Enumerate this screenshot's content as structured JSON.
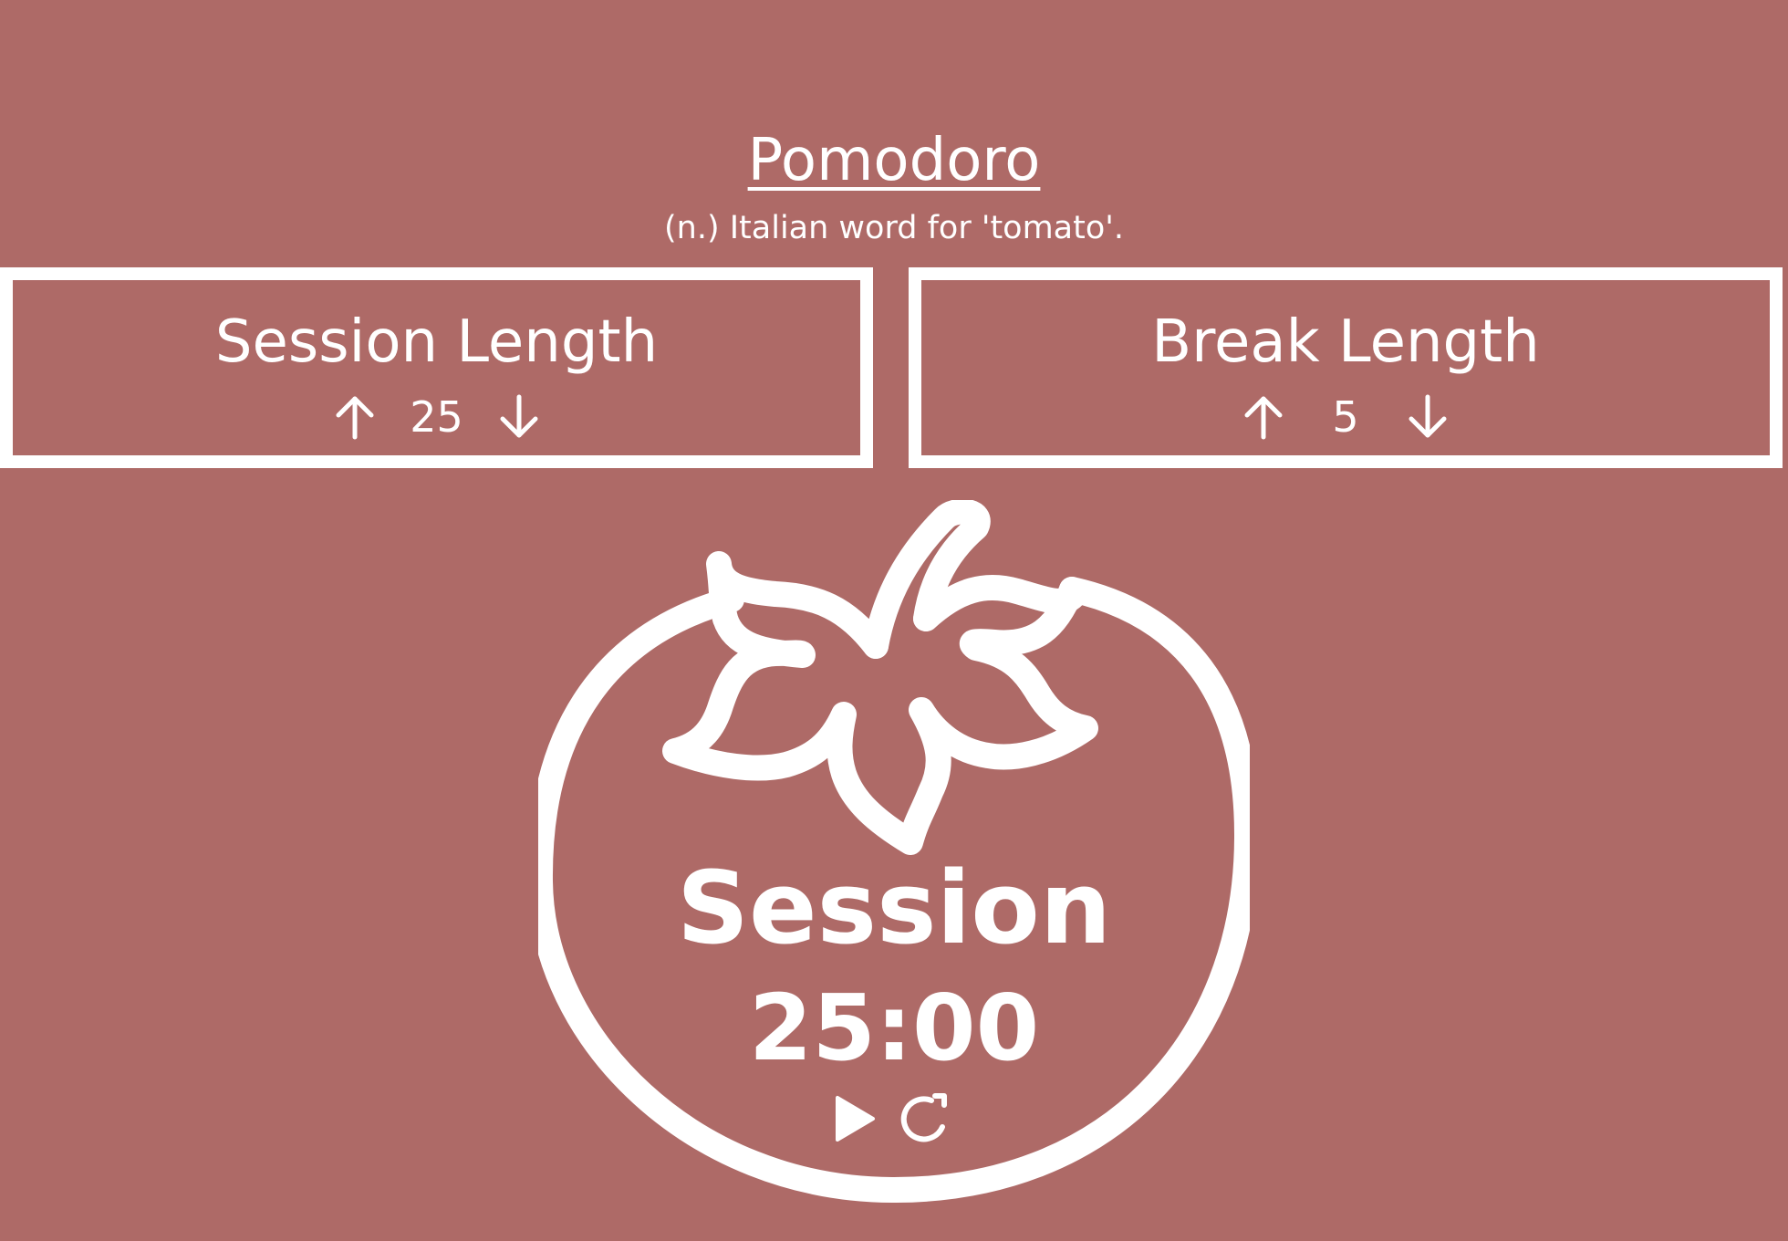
{
  "header": {
    "title": "Pomodoro",
    "subtitle": "(n.) Italian word for 'tomato'."
  },
  "session_panel": {
    "label": "Session Length",
    "value": "25",
    "increment_icon": "arrow-up-icon",
    "decrement_icon": "arrow-down-icon"
  },
  "break_panel": {
    "label": "Break Length",
    "value": "5",
    "increment_icon": "arrow-up-icon",
    "decrement_icon": "arrow-down-icon"
  },
  "timer": {
    "label": "Session",
    "time": "25:00",
    "play_icon": "play-icon",
    "reset_icon": "reset-icon"
  },
  "colors": {
    "background": "#ae6a67",
    "foreground": "#ffffff"
  }
}
